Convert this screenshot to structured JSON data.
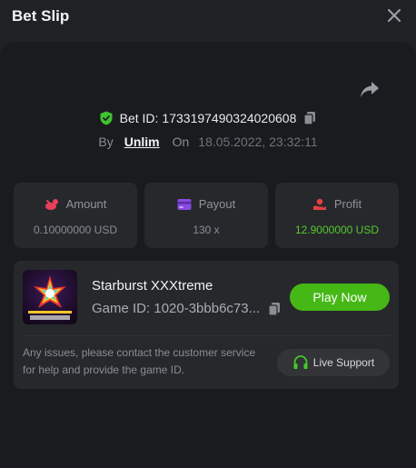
{
  "header": {
    "title": "Bet Slip",
    "close_icon": "close-icon"
  },
  "bet": {
    "id_label": "Bet ID:",
    "id_value": "1733197490324020608",
    "by_label": "By",
    "user": "Unlim",
    "on_label": "On",
    "datetime": "18.05.2022, 23:32:11"
  },
  "stats": {
    "amount": {
      "label": "Amount",
      "value": "0.10000000 USD"
    },
    "payout": {
      "label": "Payout",
      "value": "130 x"
    },
    "profit": {
      "label": "Profit",
      "value": "12.9000000 USD"
    }
  },
  "game": {
    "name": "Starburst XXXtreme",
    "id_text": "Game ID: 1020-3bbb6c73...",
    "play_label": "Play Now",
    "issue_text": "Any issues, please contact the customer service for help and provide the game ID.",
    "support_label": "Live Support"
  },
  "colors": {
    "background": "#202124",
    "panel": "#1a1b1e",
    "card": "#26282c",
    "accent_green": "#46b816",
    "profit_green": "#57c92f",
    "amount_icon": "#e8405a",
    "payout_icon": "#8a4be0",
    "profit_icon": "#e84040"
  },
  "icons": [
    "close-icon",
    "share-icon",
    "shield-check-icon",
    "copy-icon",
    "amount-icon",
    "card-icon",
    "profit-icon",
    "headset-icon"
  ]
}
